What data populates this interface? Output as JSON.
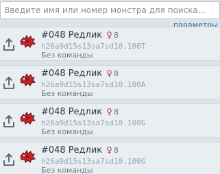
{
  "search": {
    "placeholder": "Введите имя или номер монстра для поиска..."
  },
  "params_link": "параметры в",
  "colors": {
    "background": "#dde3e8",
    "card": "#e9eef2",
    "link": "#1f6fb3",
    "sprite_red": "#c4262a"
  },
  "entries": [
    {
      "number": "#048",
      "name": "Редлик",
      "gender": "♀",
      "symbol": "8",
      "code": "h26a9d15s13sa7sd10.100T",
      "team": "Без команды"
    },
    {
      "number": "#048",
      "name": "Редлик",
      "gender": "♀",
      "symbol": "8",
      "code": "h26a9d15s13sa7sd10.100A",
      "team": "Без команды"
    },
    {
      "number": "#048",
      "name": "Редлик",
      "gender": "♀",
      "symbol": "8",
      "code": "h26a9d15s13sa7sd10.100G",
      "team": "Без команды"
    },
    {
      "number": "#048",
      "name": "Редлик",
      "gender": "♀",
      "symbol": "8",
      "code": "h26a9d15s13sa7sd10.100G",
      "team": "Без команды"
    }
  ],
  "icons": {
    "export": "share-icon",
    "monster": "monster-sprite-icon"
  }
}
